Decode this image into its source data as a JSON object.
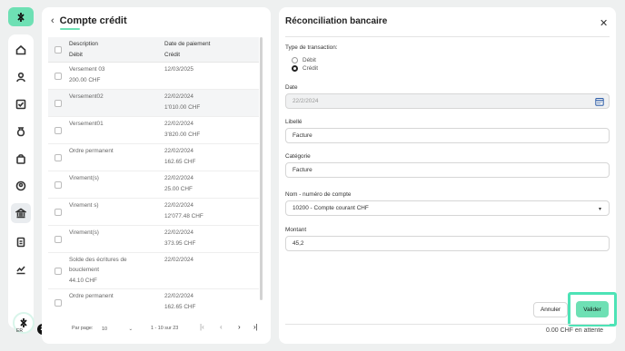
{
  "sidebar": {
    "logo_icon": "logo-icon",
    "items": [
      {
        "name": "home",
        "icon": "home-icon"
      },
      {
        "name": "contacts",
        "icon": "user-icon"
      },
      {
        "name": "tasks",
        "icon": "checkbox-icon"
      },
      {
        "name": "finance",
        "icon": "moneybag-icon"
      },
      {
        "name": "shop",
        "icon": "bag-icon"
      },
      {
        "name": "account",
        "icon": "account-icon"
      },
      {
        "name": "bank",
        "icon": "bank-icon",
        "active": true
      },
      {
        "name": "documents",
        "icon": "document-icon"
      },
      {
        "name": "reports",
        "icon": "chart-icon"
      }
    ],
    "user_initials": "ER",
    "notification_count": "23"
  },
  "left_panel": {
    "title": "Compte crédit",
    "columns": {
      "col1_top": "Description",
      "col1_bottom": "Débit",
      "col2_top": "Date de paiement",
      "col2_bottom": "Crédit"
    },
    "rows": [
      {
        "desc": "Versement 03",
        "amount": "200.00 CHF",
        "date": "12/03/2025",
        "credit": ""
      },
      {
        "desc": "Versement02",
        "amount": "",
        "date": "22/02/2024",
        "credit": "1'010.00 CHF"
      },
      {
        "desc": "Versement01",
        "amount": "",
        "date": "22/02/2024",
        "credit": "3'820.00 CHF"
      },
      {
        "desc": "Ordre permanent",
        "amount": "",
        "date": "22/02/2024",
        "credit": "162.65 CHF"
      },
      {
        "desc": "Virement(s)",
        "amount": "",
        "date": "22/02/2024",
        "credit": "25.00 CHF"
      },
      {
        "desc": "Virement s)",
        "amount": "",
        "date": "22/02/2024",
        "credit": "12'077.48 CHF"
      },
      {
        "desc": "Virement(s)",
        "amount": "",
        "date": "22/02/2024",
        "credit": "373.95 CHF"
      },
      {
        "desc": "Solde des écritures de",
        "desc2": "bouclement",
        "amount": "44.10 CHF",
        "date": "22/02/2024",
        "credit": ""
      },
      {
        "desc": "Ordre permanent",
        "amount": "",
        "date": "22/02/2024",
        "credit": "162.65 CHF"
      }
    ],
    "pagination": {
      "per_page_label": "Par page:",
      "per_page_value": "10",
      "range": "1 - 10 sur 23"
    }
  },
  "right_panel": {
    "title": "Réconciliation bancaire",
    "transaction_type_label": "Type de transaction:",
    "options": [
      "Débit",
      "Crédit"
    ],
    "selected_option": "Crédit",
    "date_label": "Date",
    "date_value": "22/2/2024",
    "libelle_label": "Libellé",
    "libelle_value": "Facture",
    "categorie_label": "Catégorie",
    "categorie_value": "Facture",
    "account_label": "Nom - numéro de compte",
    "account_value": "10200 - Compte courant CHF",
    "montant_label": "Montant",
    "montant_value": "45,2",
    "cancel_label": "Annuler",
    "validate_label": "Valider",
    "pending_text": "0.00 CHF en attente"
  },
  "colors": {
    "accent": "#6ee0b4",
    "highlight": "#4de3b6"
  }
}
